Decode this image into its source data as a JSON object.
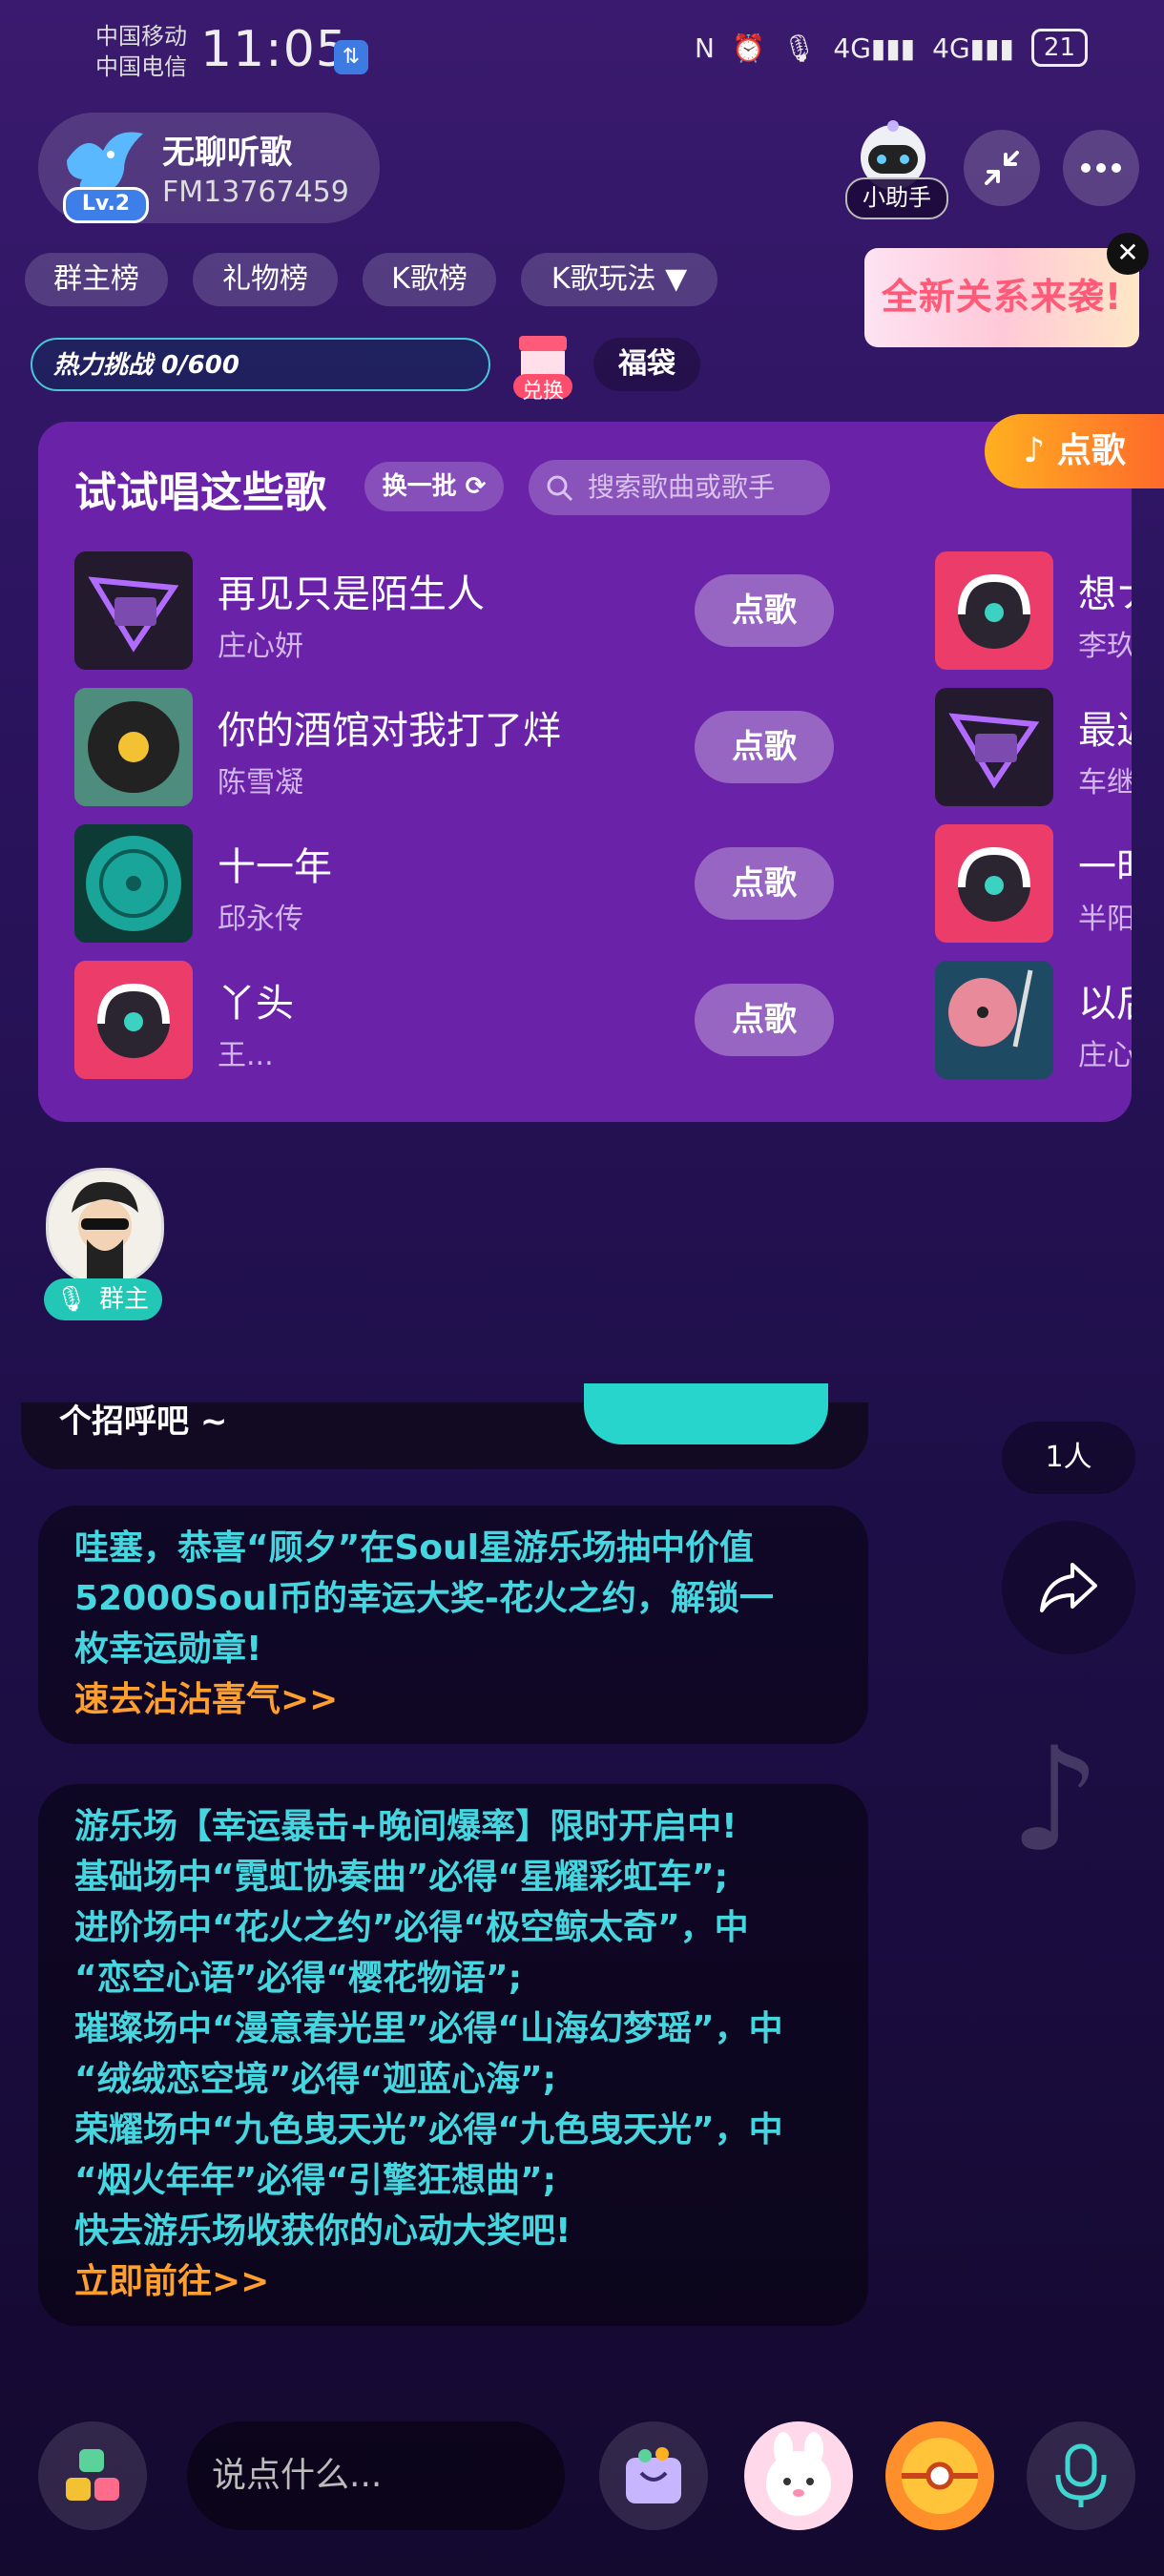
{
  "status": {
    "carrier1": "中国移动",
    "carrier2": "中国电信",
    "time": "11:05",
    "battery": "21"
  },
  "room": {
    "name": "无聊听歌",
    "id": "FM13767459",
    "level": "Lv.2",
    "helper_label": "小助手"
  },
  "tabs": [
    "群主榜",
    "礼物榜",
    "K歌榜",
    "K歌玩法 ▼"
  ],
  "banner": "全新关系来袭!",
  "heat": "热力挑战 0/600",
  "shop_label": "兑换",
  "fudai": "福袋",
  "panel": {
    "title": "试试唱这些歌",
    "change": "换一批",
    "search_placeholder": "搜索歌曲或歌手",
    "order_tag": "点歌",
    "order_label": "点歌",
    "songs": [
      {
        "title": "再见只是陌生人",
        "artist": "庄心妍"
      },
      {
        "title": "你的酒馆对我打了烊",
        "artist": "陈雪凝"
      },
      {
        "title": "十一年",
        "artist": "邱永传"
      },
      {
        "title": "丫头",
        "artist": "王..."
      }
    ],
    "songs_right": [
      {
        "title": "想ナ",
        "artist": "李玖"
      },
      {
        "title": "最近",
        "artist": "车继"
      },
      {
        "title": "一时",
        "artist": "半阳"
      },
      {
        "title": "以后",
        "artist": "庄心"
      }
    ]
  },
  "host_badge": "群主",
  "greet_text": "个招呼吧 ~",
  "count": "1人",
  "messages": [
    {
      "lines": [
        "哇塞，恭喜“顾夕”在Soul星游乐场抽中价值",
        "52000Soul币的幸运大奖-花火之约，解锁一",
        "枚幸运勋章!"
      ],
      "link": "速去沾沾喜气>>"
    },
    {
      "lines": [
        "游乐场【幸运暴击+晚间爆率】限时开启中!",
        "基础场中“霓虹协奏曲”必得“星耀彩虹车”;",
        "进阶场中“花火之约”必得“极空鲸太奇”，中",
        "“恋空心语”必得“樱花物语”;",
        "璀璨场中“漫意春光里”必得“山海幻梦瑶”，中",
        "“绒绒恋空境”必得“迦蓝心海”;",
        "荣耀场中“九色曳天光”必得“九色曳天光”，中",
        "“烟火年年”必得“引擎狂想曲”;",
        "快去游乐场收获你的心动大奖吧!"
      ],
      "link": "立即前往>>"
    }
  ],
  "input_placeholder": "说点什么..."
}
